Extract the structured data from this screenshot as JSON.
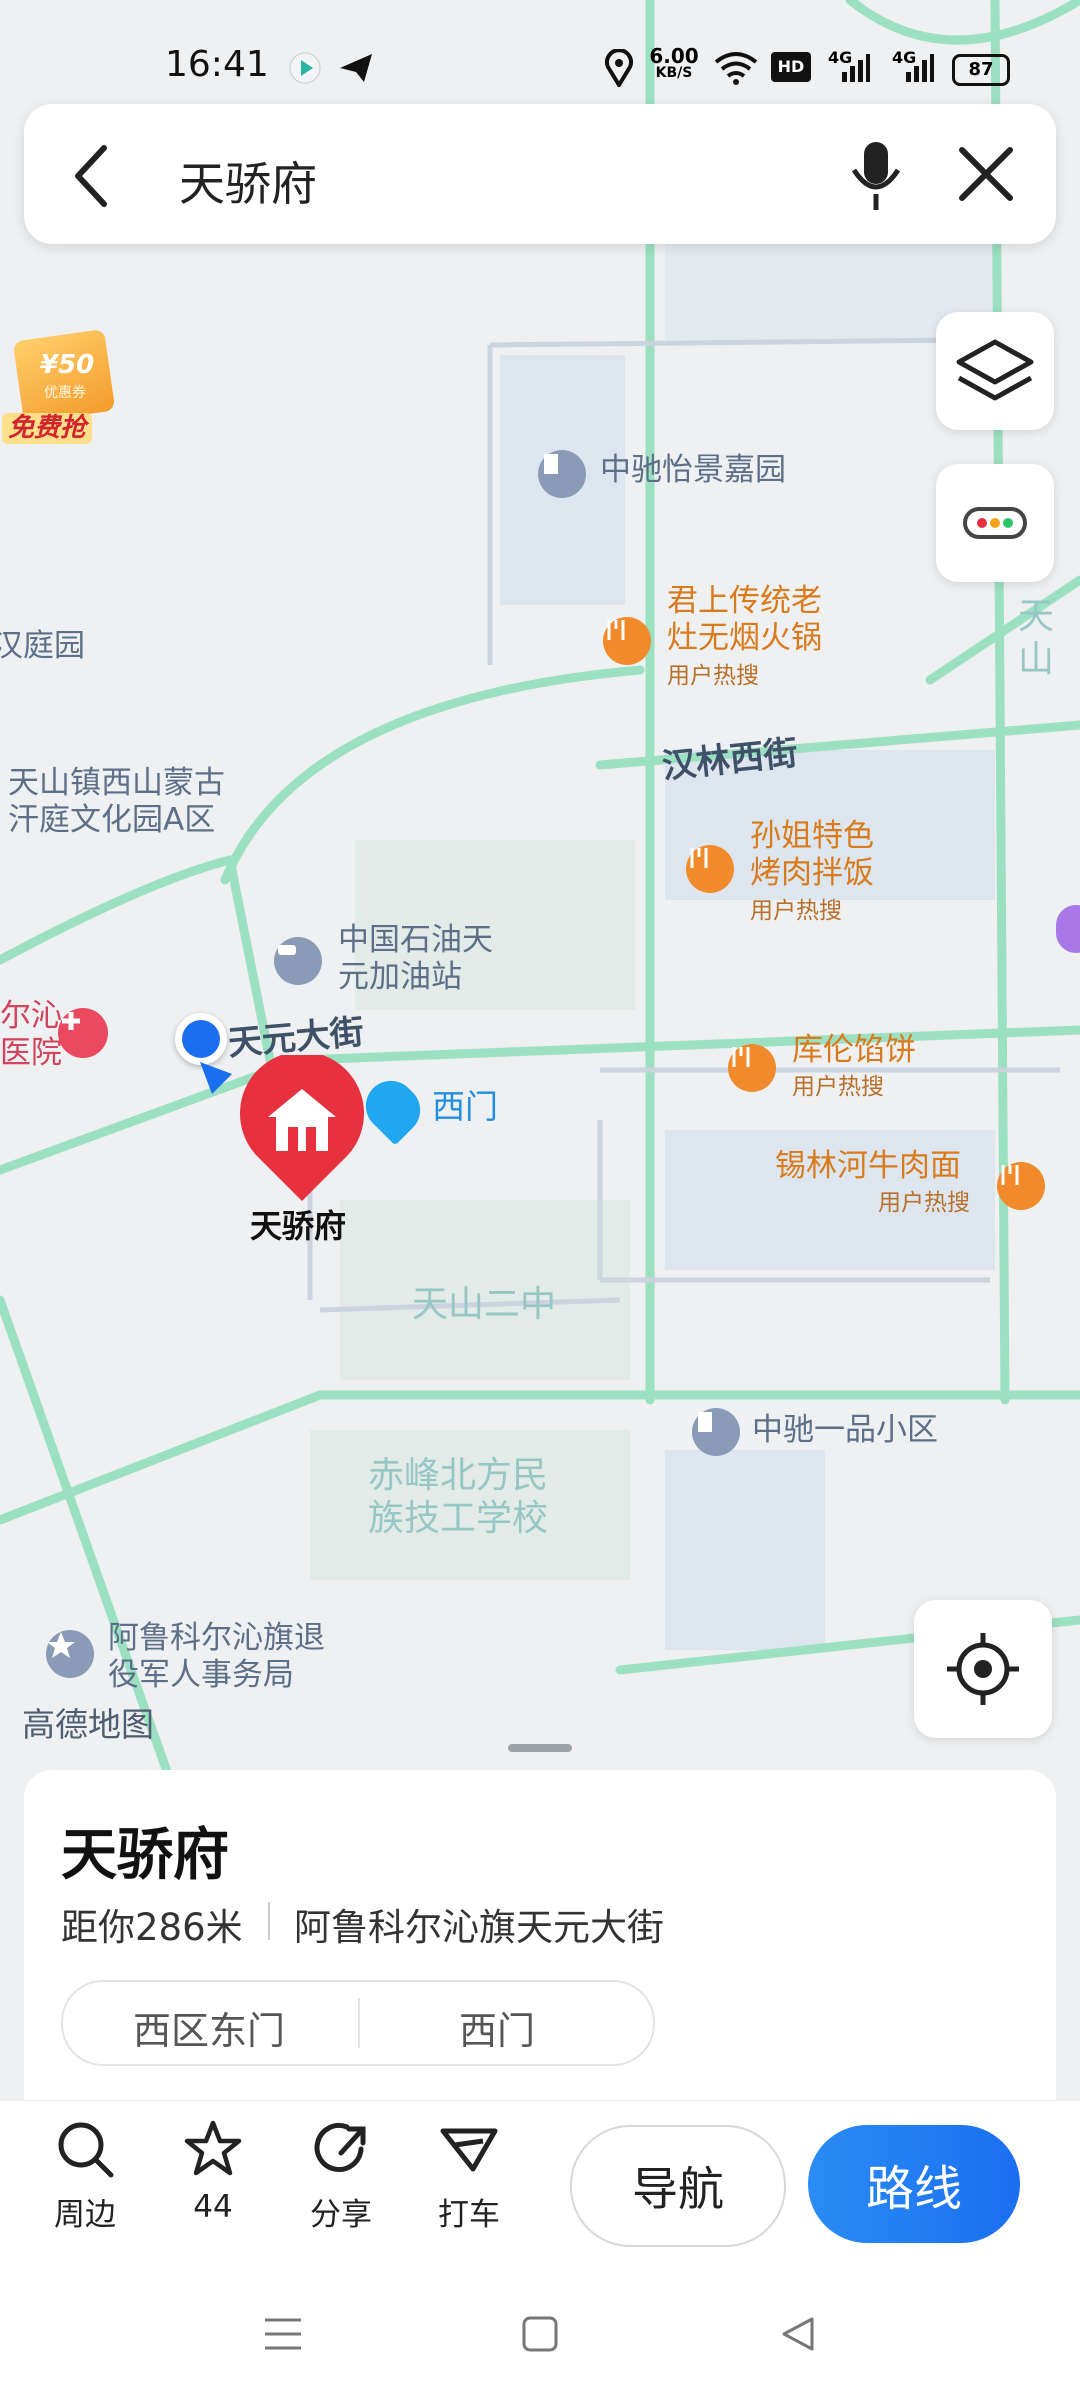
{
  "status": {
    "time": "16:41",
    "speed": "6.00",
    "speed_unit": "KB/S",
    "network1": "4G",
    "network2": "4G",
    "battery": "87"
  },
  "search": {
    "query": "天骄府"
  },
  "promo": {
    "amount": "¥50",
    "note": "优惠券",
    "label": "免费抢"
  },
  "map": {
    "roads": {
      "hanlin": "汉林西街",
      "tianyuan": "天元大街"
    },
    "places": {
      "zhongchi_yijing": "中驰怡景嘉园",
      "junshang": "君上传统老\n灶无烟火锅",
      "junshang_sub": "用户热搜",
      "hanting": "汉庭园",
      "tianshan_edge": "天山",
      "tianshan_town": "天山镇西山蒙古\n汗庭文化园A区",
      "sunjie": "孙姐特色\n烤肉拌饭",
      "sunjie_sub": "用户热搜",
      "petro": "中国石油天\n元加油站",
      "hospital": "尔沁\n医院",
      "kulun": "库伦馅饼",
      "kulun_sub": "用户热搜",
      "gate": "西门",
      "xilin": "锡林河牛肉面",
      "xilin_sub": "用户热搜",
      "selected": "天骄府",
      "school2": "天山二中",
      "zhongchi_yipin": "中驰一品小区",
      "vocational": "赤峰北方民\n族技工学校",
      "veterans": "阿鲁科尔沁旗退\n役军人事务局",
      "brand": "高德地图"
    }
  },
  "place": {
    "name": "天骄府",
    "distance": "距你286米",
    "address": "阿鲁科尔沁旗天元大街",
    "gates": [
      "西区东门",
      "西门"
    ]
  },
  "actions": {
    "nearby": "周边",
    "favorites": "44",
    "share": "分享",
    "taxi": "打车",
    "navigate": "导航",
    "route": "路线"
  },
  "colors": {
    "accent": "#1a73f0",
    "pin": "#e8313f",
    "road": "#8ed9b4",
    "orange": "#d97b1c"
  }
}
